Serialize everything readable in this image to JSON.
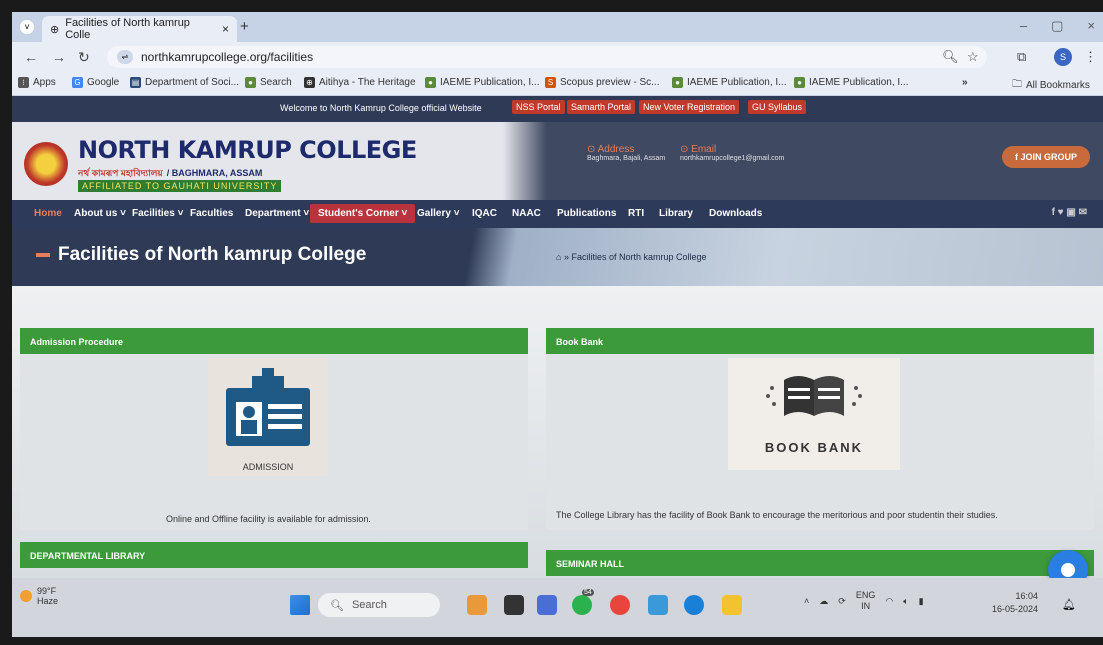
{
  "browser": {
    "tab_title": "Facilities of North kamrup Colle",
    "url": "northkamrupcollege.org/facilities",
    "bookmarks": [
      "Apps",
      "Google",
      "Department of Soci...",
      "Search",
      "Aitihya - The Heritage",
      "IAEME Publication, I...",
      "Scopus preview - Sc...",
      "IAEME Publication, I...",
      "IAEME Publication, I..."
    ],
    "all_bookmarks": "All Bookmarks",
    "overflow": "»",
    "avatar_initial": "S"
  },
  "site": {
    "welcome": "Welcome to North Kamrup College official Website",
    "top_links": [
      "NSS Portal",
      "Samarth Portal",
      "New Voter Registration",
      "GU Syllabus"
    ],
    "college_name": "NORTH KAMRUP COLLEGE",
    "college_assamese": "নৰ্থ কামৰূপ মহাবিদ্যালয়",
    "college_place": "/ BAGHMARA, ASSAM",
    "affiliation": "AFFILIATED TO GAUHATI UNIVERSITY",
    "address_label": "Address",
    "address_value": "Baghmara, Bajali, Assam",
    "email_label": "Email",
    "email_value": "northkamrupcollege1@gmail.com",
    "join_button": "f JOIN GROUP",
    "nav": [
      "Home",
      "About us ˅",
      "Facilities ˅",
      "Faculties",
      "Department ˅",
      "Student's Corner ˅",
      "Gallery ˅",
      "IQAC",
      "NAAC",
      "Publications",
      "RTI",
      "Library",
      "Downloads"
    ],
    "social_icons": "f ♥ ▣ ✉",
    "page_title": "Facilities of North kamrup College",
    "breadcrumb": "» Facilities of North kamrup College",
    "panels": {
      "admission": {
        "title": "Admission Procedure",
        "image_label": "ADMISSION",
        "caption": "Online and Offline facility is available for admission."
      },
      "bookbank": {
        "title": "Book Bank",
        "image_label": "BOOK BANK",
        "caption": "The College Library has the facility of Book Bank to encourage the meritorious and poor studentin their studies."
      },
      "library": {
        "title": "DEPARTMENTAL LIBRARY"
      },
      "seminar": {
        "title": "SEMINAR HALL"
      }
    }
  },
  "taskbar": {
    "weather_temp": "99°F",
    "weather_desc": "Haze",
    "search": "Search",
    "lang_top": "ENG",
    "lang_bottom": "IN",
    "time": "16:04",
    "date": "16-05-2024",
    "badge": "54"
  },
  "colors": {
    "panel_green": "#3c9a3a",
    "nav_bg": "#2d3a5a",
    "accent_red": "#c0392b",
    "accent_orange": "#e67e5b"
  }
}
